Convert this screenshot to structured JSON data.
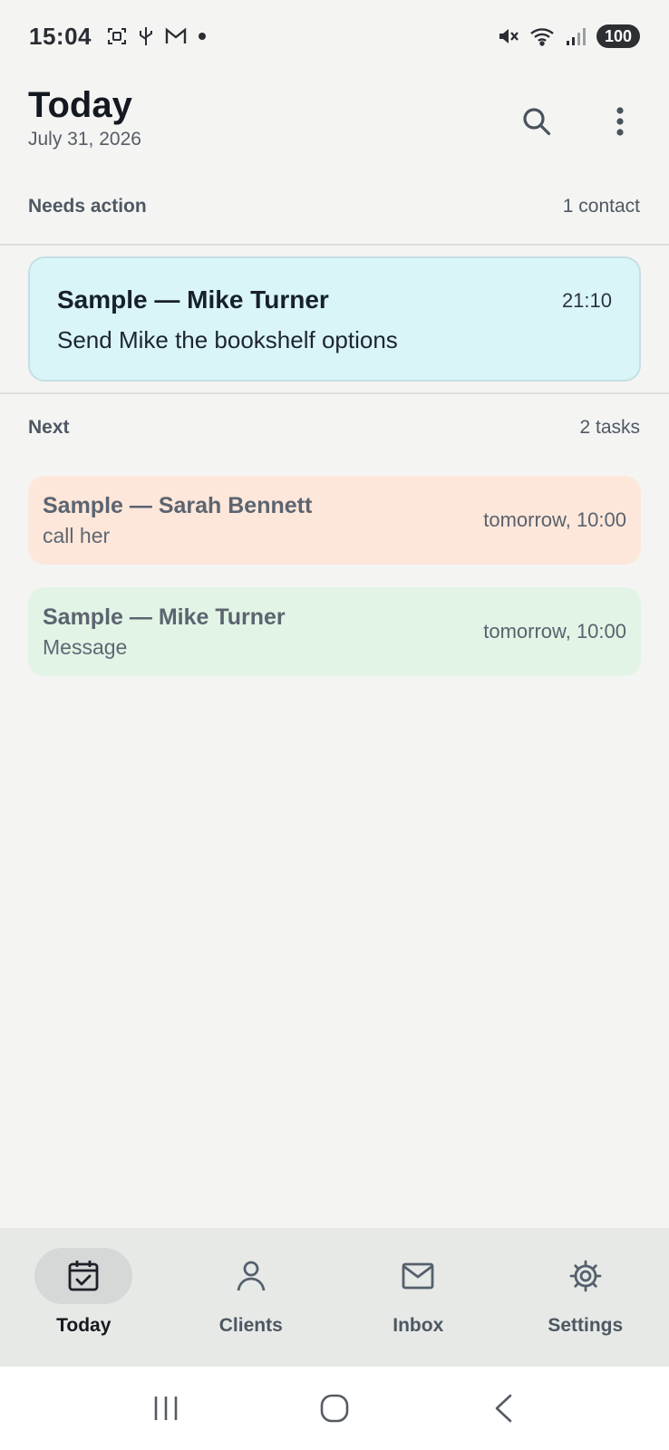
{
  "status_bar": {
    "time": "15:04",
    "battery": "100",
    "left_icons": [
      "screenshot-icon",
      "usb-icon",
      "gmail-icon",
      "dot-icon"
    ],
    "right_icons": [
      "mute-icon",
      "wifi-icon",
      "signal-icon"
    ]
  },
  "header": {
    "title": "Today",
    "date": "July 31, 2026",
    "actions": [
      "search-icon",
      "more-vert-icon"
    ]
  },
  "needs_action": {
    "title": "Needs action",
    "count": "1 contact",
    "items": [
      {
        "name": "Sample — Mike Turner",
        "task": "Send Mike the bookshelf options",
        "time": "21:10",
        "color": "#d9f5f8"
      }
    ]
  },
  "next": {
    "title": "Next",
    "count": "2 tasks",
    "items": [
      {
        "name": "Sample — Sarah Bennett",
        "task": "call her",
        "time": "tomorrow, 10:00",
        "color": "#fde7da"
      },
      {
        "name": "Sample — Mike Turner",
        "task": "Message",
        "time": "tomorrow, 10:00",
        "color": "#e2f4e6"
      }
    ]
  },
  "bottom_nav": {
    "items": [
      {
        "label": "Today",
        "icon": "calendar-check-icon",
        "active": true
      },
      {
        "label": "Clients",
        "icon": "person-icon",
        "active": false
      },
      {
        "label": "Inbox",
        "icon": "mail-icon",
        "active": false
      },
      {
        "label": "Settings",
        "icon": "gear-icon",
        "active": false
      }
    ]
  },
  "system_nav": [
    "recents-icon",
    "home-icon",
    "back-icon"
  ],
  "colors": {
    "background": "#f4f5f3",
    "nav_background": "#e7e9e7",
    "active_pill": "#d5d8d6"
  }
}
